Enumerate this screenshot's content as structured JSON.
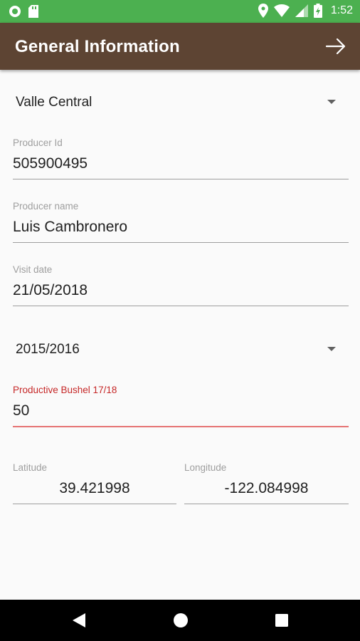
{
  "status_bar": {
    "time": "1:52",
    "left_icons": [
      "circle-app-icon",
      "sd-card-icon"
    ],
    "right_icons": [
      "location-icon",
      "wifi-icon",
      "signal-icon",
      "battery-icon"
    ],
    "color": "#4cb050"
  },
  "app_bar": {
    "title": "General Information",
    "action_icon": "arrow-forward-icon",
    "color": "#5d4433"
  },
  "form": {
    "region_select": {
      "value": "Valle Central"
    },
    "producer_id": {
      "label": "Producer Id",
      "value": "505900495"
    },
    "producer_name": {
      "label": "Producer name",
      "value": "Luis Cambronero"
    },
    "visit_date": {
      "label": "Visit date",
      "value": "21/05/2018"
    },
    "season_select": {
      "value": "2015/2016"
    },
    "productive_bushel": {
      "label": "Productive Bushel 17/18",
      "value": "50",
      "state": "error"
    },
    "latitude": {
      "label": "Latitude",
      "value": "39.421998"
    },
    "longitude": {
      "label": "Longitude",
      "value": "-122.084998"
    }
  },
  "nav_bar": {
    "buttons": [
      "back-icon",
      "home-icon",
      "recents-icon"
    ]
  },
  "colors": {
    "error": "#c62828",
    "label": "#9e9e9e",
    "text": "#212121"
  }
}
